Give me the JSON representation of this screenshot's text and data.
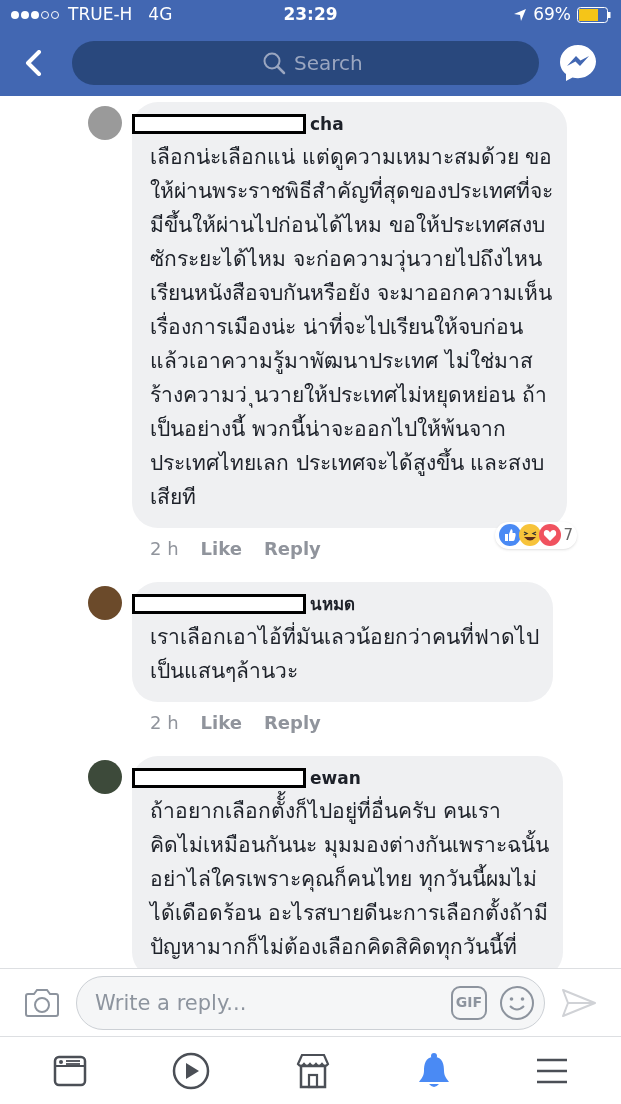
{
  "status_bar": {
    "carrier": "TRUE-H",
    "network": "4G",
    "time": "23:29",
    "battery": "69%"
  },
  "nav": {
    "search": {
      "placeholder": "Search"
    }
  },
  "comments": [
    {
      "name": "cha",
      "body": "เลือกน่ะเลือกแน่ แต่ดูความเหมาะสมด้วย ขอ\nให้ผ่านพระราชพิธีสำคัญที่สุดของประเทศที่จะ\nมีขึ้นให้ผ่านไปก่อนได้ไหม ขอให้ประเทศสงบ\nซักระยะได้ไหม จะก่อความวุ่นวายไปถึงไหน\nเรียนหนังสือจบกันหรือยัง จะมาออกความเห็น\nเรื่องการเมืองน่ะ น่าที่จะไปเรียนให้จบก่อน\nแล้วเอาความรู้มาพัฒนาประเทศ ไม่ใช่มาส\nร้างความว่ ุนวายให้ประเทศไม่หยุดหย่อน ถ้า\nเป็นอย่างนี้ พวกนี้น่าจะออกไปให้พ้นจาก\nประเทศไทยเลก ประเทศจะได้สูงขึ้น และสงบ\nเสียที",
      "time": "2 h",
      "like": "Like",
      "reply": "Reply",
      "reactions": "7"
    },
    {
      "name": "นหมด",
      "body": "เราเลือกเอาไอ้ที่มันเลวน้อยกว่าคนที่ฟาดไป\nเป็นแสนๆล้านวะ",
      "time": "2 h",
      "like": "Like",
      "reply": "Reply"
    },
    {
      "name": "ewan",
      "body": "ถ้าอยากเลือกตัั้งก็ไปอยู่ที่อื่นครับ คนเรา\nคิดไม่เหมือนกันนะ มุมมองต่างกันเพราะฉนั้น\nอย่าไล่ใครเพราะคุณก็คนไทย ทุกวันนี้ผมไม่\nได้เดือดร้อน อะไรสบายดีนะการเลือกตั้งถ้ามี\nปัญหามากก็ไม่ต้องเลือกคิดสิคิดทุกวันนี้ที่"
    }
  ],
  "composer": {
    "placeholder": "Write a reply...",
    "gif": "GIF"
  },
  "tab_bar": [
    {
      "kind": "news",
      "selected": false
    },
    {
      "kind": "video",
      "selected": false
    },
    {
      "kind": "market",
      "selected": false
    },
    {
      "kind": "bell",
      "selected": true
    },
    {
      "kind": "menu",
      "selected": false
    }
  ]
}
